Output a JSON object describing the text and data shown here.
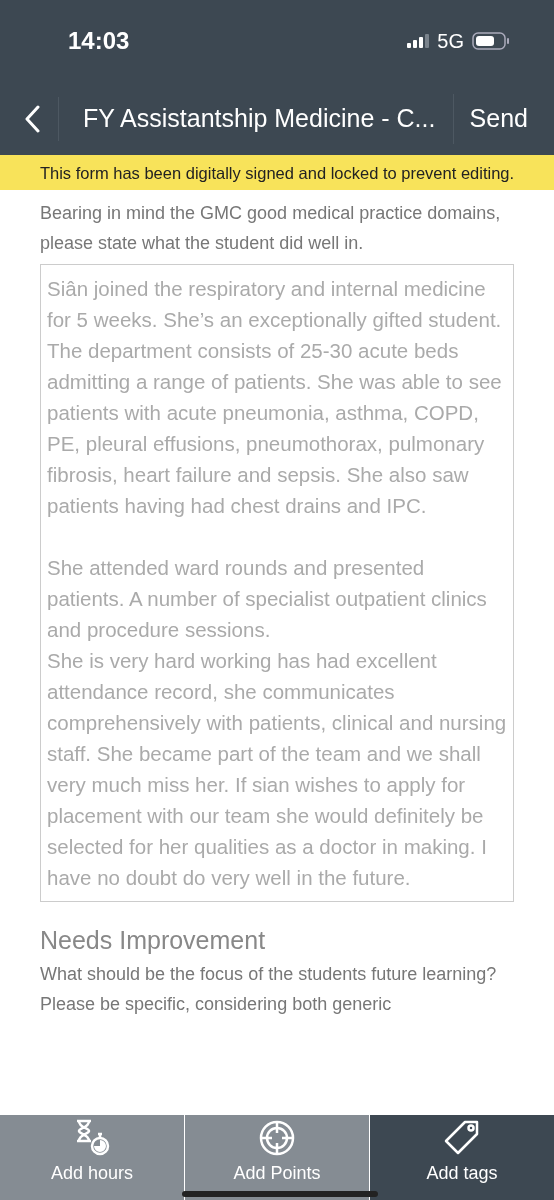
{
  "status_bar": {
    "time": "14:03",
    "network": "5G"
  },
  "nav": {
    "title": "FY Assistantship Medicine - C...",
    "action": "Send"
  },
  "banner": "This form has been digitally signed and locked to prevent editing.",
  "sections": [
    {
      "prompt": "Bearing in mind the GMC good medical practice domains, please state what the student did well in.",
      "answer": "Siân joined the respiratory and internal medicine for 5 weeks. She’s an exceptionally gifted student.\nThe department consists of 25-30 acute beds admitting a range of patients. She was able to see patients with acute pneumonia, asthma, COPD, PE, pleural effusions, pneumothorax, pulmonary fibrosis, heart failure and sepsis. She also saw patients having had chest drains and IPC.\n\nShe attended ward rounds and presented patients. A number of specialist outpatient clinics and procedure sessions.\nShe is very hard working has had excellent attendance record, she communicates comprehensively with patients, clinical and nursing staff. She became part of the team and we shall very much miss her. If sian wishes to apply for placement with our team she would definitely be selected for her qualities as a doctor in making. I have no doubt do very well in the future."
    },
    {
      "heading": "Needs Improvement",
      "prompt": "What should be the focus of the students future learning? Please be specific, considering both generic"
    }
  ],
  "tabs": [
    {
      "kind": "hours",
      "label": "Add hours",
      "selected": false
    },
    {
      "kind": "points",
      "label": "Add Points",
      "selected": false
    },
    {
      "kind": "tags",
      "label": "Add tags",
      "selected": true
    }
  ]
}
